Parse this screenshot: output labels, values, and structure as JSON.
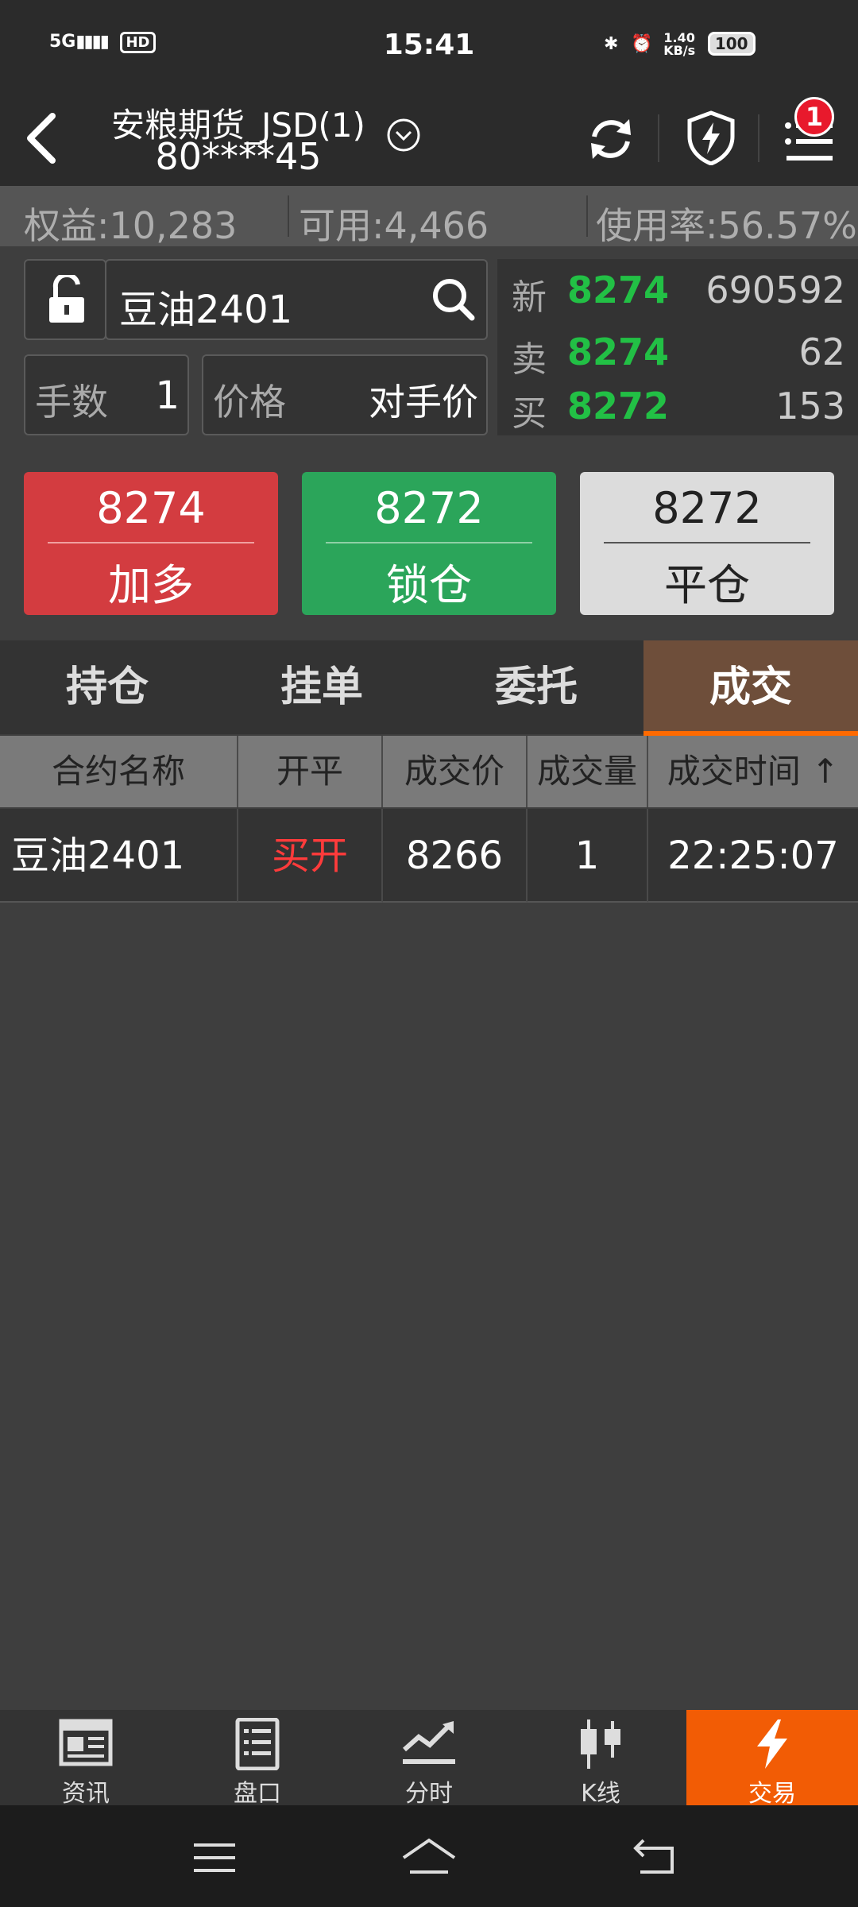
{
  "status_bar": {
    "network": "5G",
    "hd": "HD",
    "time": "15:41",
    "speed_value": "1.40",
    "speed_unit": "KB/s",
    "battery": "100"
  },
  "header": {
    "title_line1": "安粮期货_JSD(1)",
    "title_line2": "80****45",
    "notification_count": "1"
  },
  "equity_bar": {
    "equity": "权益:10,283",
    "available": "可用:4,466",
    "usage": "使用率:56.57%"
  },
  "order": {
    "contract": "豆油2401",
    "qty_label": "手数",
    "qty_value": "1",
    "price_label": "价格",
    "price_value": "对手价"
  },
  "quote": {
    "last_label": "新",
    "last_price": "8274",
    "last_volume": "690592",
    "ask_label": "卖",
    "ask_price": "8274",
    "ask_volume": "62",
    "bid_label": "买",
    "bid_price": "8272",
    "bid_volume": "153"
  },
  "actions": [
    {
      "price": "8274",
      "label": "加多",
      "color": "#d33c40"
    },
    {
      "price": "8272",
      "label": "锁仓",
      "color": "#2ba55a"
    },
    {
      "price": "8272",
      "label": "平仓",
      "color": "#dcdcdc"
    }
  ],
  "tabs": [
    "持仓",
    "挂单",
    "委托",
    "成交"
  ],
  "active_tab": "成交",
  "table": {
    "headers": [
      "合约名称",
      "开平",
      "成交价",
      "成交量",
      "成交时间 ↑"
    ],
    "rows": [
      {
        "contract": "豆油2401",
        "open_close": "买开",
        "price": "8266",
        "volume": "1",
        "time": "22:25:07"
      }
    ]
  },
  "bottom_nav": [
    {
      "label": "资讯",
      "icon": "news-icon"
    },
    {
      "label": "盘口",
      "icon": "orderbook-icon"
    },
    {
      "label": "分时",
      "icon": "timeshare-chart-icon"
    },
    {
      "label": "K线",
      "icon": "candlestick-icon"
    },
    {
      "label": "交易",
      "icon": "lightning-icon"
    }
  ],
  "active_nav": "交易",
  "colors": {
    "accent": "#f25c05",
    "up": "#22c045",
    "buy_red": "#ff3b3b",
    "tab_active": "#6e4e3a"
  }
}
